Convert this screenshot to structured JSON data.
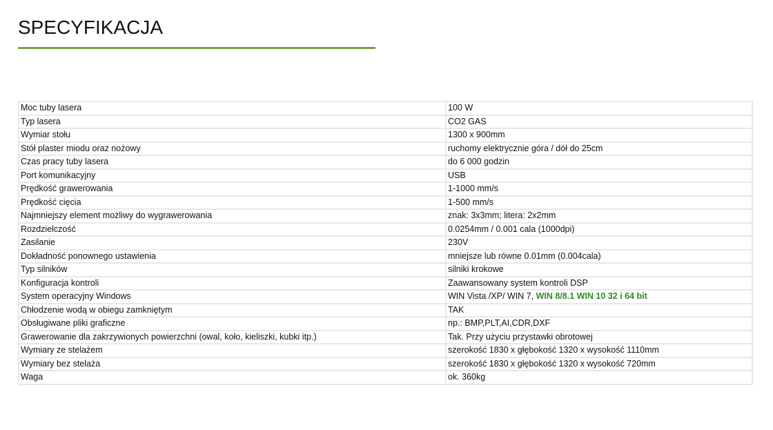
{
  "title": "SPECYFIKACJA",
  "accent_color": "#7aa33e",
  "rows": [
    {
      "label": "Moc tuby lasera",
      "value": "100 W"
    },
    {
      "label": "Typ lasera",
      "value": "CO2 GAS"
    },
    {
      "label": "Wymiar stołu",
      "value": "1300 x 900mm"
    },
    {
      "label": "Stół plaster miodu oraz nożowy",
      "value": "ruchomy elektrycznie góra / dół do 25cm"
    },
    {
      "label": "Czas pracy tuby lasera",
      "value": "do 6 000 godzin"
    },
    {
      "label": "Port komunikacyjny",
      "value": "USB"
    },
    {
      "label": "Prędkość grawerowania",
      "value": "1-1000 mm/s"
    },
    {
      "label": "Prędkość cięcia",
      "value": "1-500 mm/s"
    },
    {
      "label": "Najmniejszy element możliwy do wygrawerowania",
      "value": "znak: 3x3mm; litera: 2x2mm"
    },
    {
      "label": "Rozdzielczość",
      "value": "0.0254mm / 0.001 cala (1000dpi)"
    },
    {
      "label": "Zasilanie",
      "value": "230V"
    },
    {
      "label": "Dokładność ponownego ustawienia",
      "value": "mniejsze lub równe 0.01mm (0.004cala)"
    },
    {
      "label": "Typ silników",
      "value": "silniki krokowe"
    },
    {
      "label": "Konfiguracja kontroli",
      "value": "Zaawansowany system kontroli DSP"
    },
    {
      "label": "System operacyjny Windows",
      "value": "WIN Vista /XP/ WIN 7, ",
      "value_highlight": "WIN 8/8.1 WIN 10 32 i 64 bit"
    },
    {
      "label": "Chłodzenie wodą w obiegu zamkniętym",
      "value": "TAK"
    },
    {
      "label": "Obsługiwane pliki graficzne",
      "value": "np.: BMP,PLT,AI,CDR,DXF"
    },
    {
      "label": "Grawerowanie dla zakrzywionych powierzchni (owal, koło, kieliszki, kubki itp.)",
      "value": "Tak. Przy użyciu przystawki obrotowej"
    },
    {
      "label": "Wymiary ze stelażem",
      "value": "szerokość 1830 x głębokość 1320 x wysokość 1110mm"
    },
    {
      "label": "Wymiary bez stelaża",
      "value": "szerokość 1830 x głębokość 1320 x wysokość 720mm"
    },
    {
      "label": "Waga",
      "value": "ok. 360kg"
    }
  ]
}
